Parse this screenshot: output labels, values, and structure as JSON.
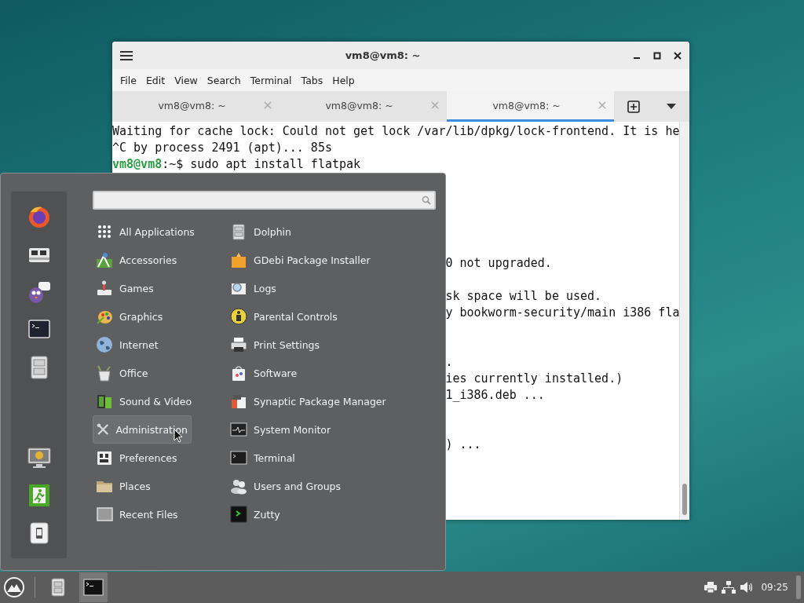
{
  "terminal_window": {
    "title": "vm8@vm8: ~",
    "menu": [
      "File",
      "Edit",
      "View",
      "Search",
      "Terminal",
      "Tabs",
      "Help"
    ],
    "tabs": [
      {
        "label": "vm8@vm8: ~",
        "selected": false
      },
      {
        "label": "vm8@vm8: ~",
        "selected": false
      },
      {
        "label": "vm8@vm8: ~",
        "selected": true
      }
    ],
    "lines": [
      {
        "kind": "output",
        "text": "Waiting for cache lock: Could not get lock /var/lib/dpkg/lock-frontend. It is he"
      },
      {
        "kind": "output",
        "text": "^C by process 2491 (apt)... 85s"
      },
      {
        "kind": "prompt",
        "user": "vm8@vm8",
        "text": ":~$ sudo apt install flatpak"
      },
      {
        "kind": "blank"
      },
      {
        "kind": "blank"
      },
      {
        "kind": "blank"
      },
      {
        "kind": "blank"
      },
      {
        "kind": "blank"
      },
      {
        "kind": "tail",
        "text": "0 not upgraded."
      },
      {
        "kind": "blank"
      },
      {
        "kind": "tail",
        "text": "sk space will be used."
      },
      {
        "kind": "tail",
        "text": "y bookworm-security/main i386 fla"
      },
      {
        "kind": "blank"
      },
      {
        "kind": "blank"
      },
      {
        "kind": "tail",
        "text": "."
      },
      {
        "kind": "tail",
        "text": "ies currently installed.)"
      },
      {
        "kind": "tail",
        "text": "1_i386.deb ..."
      },
      {
        "kind": "blank"
      },
      {
        "kind": "blank"
      },
      {
        "kind": "tail",
        "text": ") ..."
      }
    ]
  },
  "app_menu": {
    "categories": [
      {
        "label": "All Applications",
        "selected": false
      },
      {
        "label": "Accessories",
        "selected": false
      },
      {
        "label": "Games",
        "selected": false
      },
      {
        "label": "Graphics",
        "selected": false
      },
      {
        "label": "Internet",
        "selected": false
      },
      {
        "label": "Office",
        "selected": false
      },
      {
        "label": "Sound & Video",
        "selected": false
      },
      {
        "label": "Administration",
        "selected": true
      },
      {
        "label": "Preferences",
        "selected": false
      },
      {
        "label": "Places",
        "selected": false
      },
      {
        "label": "Recent Files",
        "selected": false
      }
    ],
    "apps": [
      {
        "label": "Dolphin"
      },
      {
        "label": "GDebi Package Installer"
      },
      {
        "label": "Logs"
      },
      {
        "label": "Parental Controls"
      },
      {
        "label": "Print Settings"
      },
      {
        "label": "Software"
      },
      {
        "label": "Synaptic Package Manager"
      },
      {
        "label": "System Monitor"
      },
      {
        "label": "Terminal"
      },
      {
        "label": "Users and Groups"
      },
      {
        "label": "Zutty"
      }
    ]
  },
  "taskbar": {
    "tasks": [
      {
        "selected": false
      },
      {
        "selected": true
      }
    ],
    "clock": "09:25"
  }
}
